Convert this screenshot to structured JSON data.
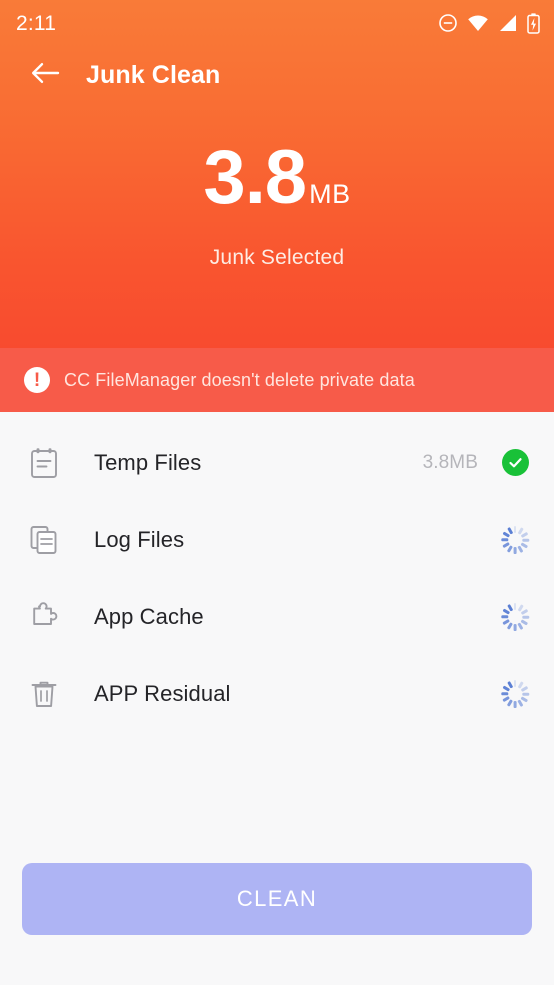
{
  "status_bar": {
    "time": "2:11",
    "icons": [
      "do-not-disturb-icon",
      "wifi-icon",
      "cellular-signal-icon",
      "battery-charging-icon"
    ]
  },
  "toolbar": {
    "back_icon": "back-arrow-icon",
    "title": "Junk Clean"
  },
  "summary": {
    "size_value": "3.8",
    "size_unit": "MB",
    "caption": "Junk Selected"
  },
  "notice": {
    "icon": "exclamation-icon",
    "text": "CC FileManager doesn't delete private data"
  },
  "list": {
    "items": [
      {
        "label": "Temp Files",
        "icon": "clipboard-icon",
        "size": "3.8MB",
        "status": "done"
      },
      {
        "label": "Log Files",
        "icon": "documents-icon",
        "size": "",
        "status": "scanning"
      },
      {
        "label": "App Cache",
        "icon": "puzzle-piece-icon",
        "size": "",
        "status": "scanning"
      },
      {
        "label": "APP Residual",
        "icon": "trash-icon",
        "size": "",
        "status": "scanning"
      }
    ]
  },
  "footer": {
    "clean_label": "CLEAN"
  },
  "colors": {
    "header_gradient_top": "#f97b38",
    "header_gradient_bottom": "#f84b2f",
    "notice_bg": "#f75b49",
    "body_bg": "#f8f8f9",
    "check_green": "#19c138",
    "clean_button": "#aeb4f4",
    "spinner_blue": "#5b7fd4",
    "row_label": "#242428",
    "row_size": "#b5b5ba"
  }
}
